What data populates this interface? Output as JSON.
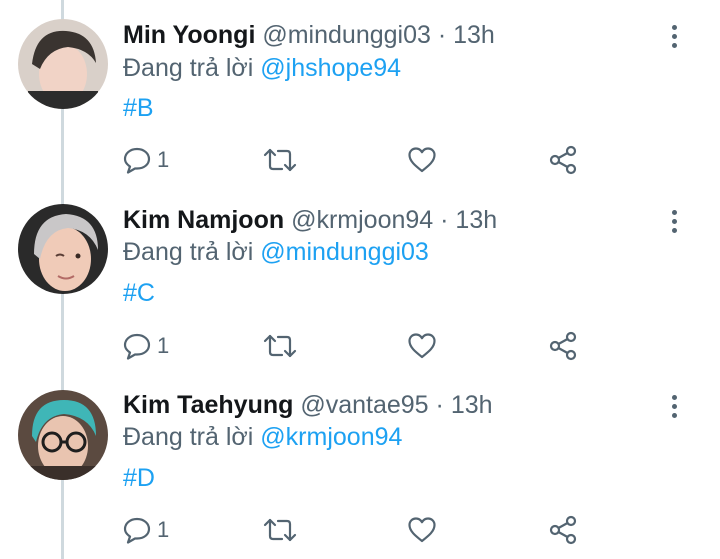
{
  "thread": [
    {
      "name": "Min Yoongi",
      "handle": "@mindunggi03",
      "separator": "·",
      "time": "13h",
      "reply_prefix": "Đang trả lời",
      "reply_to": "@jhshope94",
      "hashtag": "#B",
      "reply_count": "1",
      "avatar_colors": {
        "bg": "#d9d0c9",
        "hair": "#3a3430",
        "skin": "#f1d3c6"
      }
    },
    {
      "name": "Kim Namjoon",
      "handle": "@krmjoon94",
      "separator": "·",
      "time": "13h",
      "reply_prefix": "Đang trả lời",
      "reply_to": "@mindunggi03",
      "hashtag": "#C",
      "reply_count": "1",
      "avatar_colors": {
        "bg": "#2a2a2a",
        "hair": "#c9c7c8",
        "skin": "#f0cbb8"
      }
    },
    {
      "name": "Kim Taehyung",
      "handle": "@vantae95",
      "separator": "·",
      "time": "13h",
      "reply_prefix": "Đang trả lời",
      "reply_to": "@krmjoon94",
      "hashtag": "#D",
      "reply_count": "1",
      "avatar_colors": {
        "bg": "#5b4a40",
        "hair": "#3fb6b7",
        "skin": "#e9c4b0"
      }
    }
  ],
  "icons": {
    "reply": "comment-icon",
    "retweet": "retweet-icon",
    "like": "heart-icon",
    "share": "share-icon",
    "more": "more-vertical-icon"
  },
  "colors": {
    "accent": "#1da1f2",
    "secondary_text": "#536471",
    "primary_text": "#14171a",
    "thread_line": "#cfd9de"
  }
}
